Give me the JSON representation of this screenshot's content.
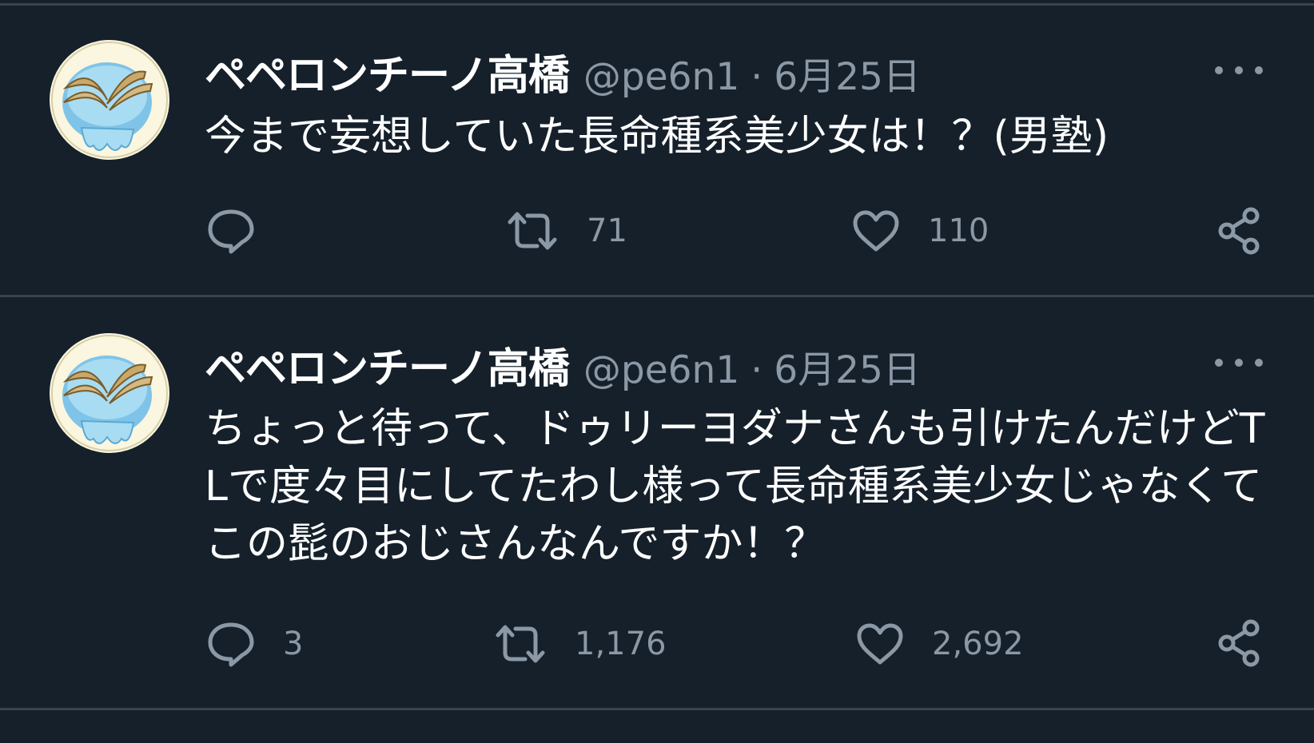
{
  "tweets": [
    {
      "author_name": "ペペロンチーノ高橋",
      "handle": "@pe6n1",
      "separator": "·",
      "date": "6月25日",
      "text": "今まで妄想していた長命種系美少女は！？(男塾)",
      "reply_count": "",
      "retweet_count": "71",
      "like_count": "110"
    },
    {
      "author_name": "ペペロンチーノ高橋",
      "handle": "@pe6n1",
      "separator": "·",
      "date": "6月25日",
      "text": "ちょっと待って、ドゥリーヨダナさんも引けたんだけどTLで度々目にしてたわし様って長命種系美少女じゃなくてこの髭のおじさんなんですか！？",
      "reply_count": "3",
      "retweet_count": "1,176",
      "like_count": "2,692"
    }
  ],
  "colors": {
    "background": "#15202b",
    "divider": "#38444d",
    "secondary_text": "#8b98a5",
    "primary_text": "#ffffff"
  },
  "icons": [
    "more-icon",
    "reply-icon",
    "retweet-icon",
    "like-icon",
    "share-icon"
  ]
}
